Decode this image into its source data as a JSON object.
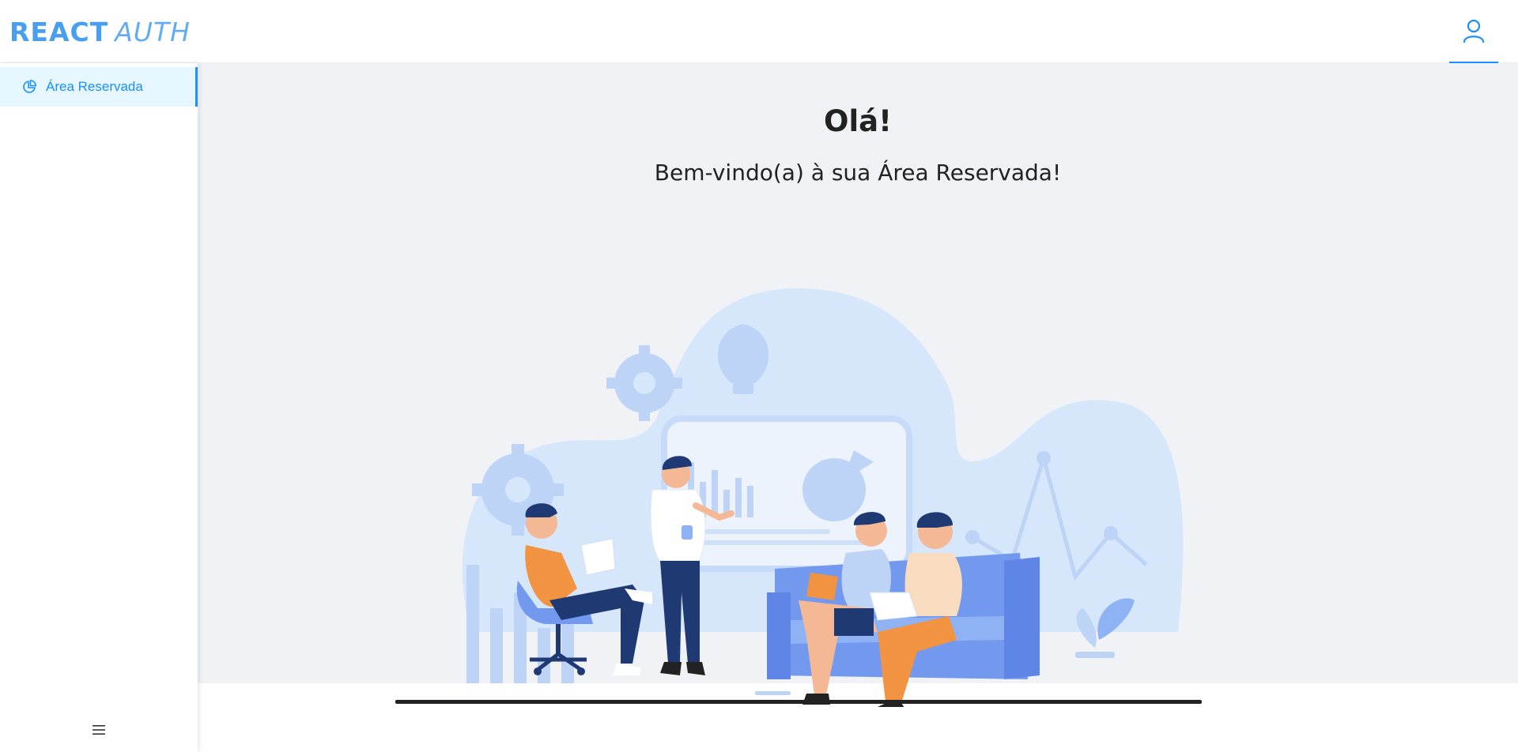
{
  "header": {
    "logo_bold": "REACT",
    "logo_light": "AUTH",
    "user_icon": "user-icon"
  },
  "sidebar": {
    "items": [
      {
        "label": "Área Reservada",
        "icon": "pie-chart-icon",
        "active": true
      }
    ],
    "collapse_icon": "menu-icon"
  },
  "main": {
    "title": "Olá!",
    "subtitle": "Bem-vindo(a) à sua Área Reservada!",
    "illustration": "team-meeting-illustration"
  },
  "colors": {
    "accent": "#1890ff",
    "logo": "#4a9ef0",
    "content_bg": "#f0f2f5",
    "active_item_bg": "#e6f7ff",
    "blob": "#d6e6fb",
    "orange": "#f19340",
    "blue_sofa": "#7399ef",
    "navy": "#1f3a73"
  }
}
